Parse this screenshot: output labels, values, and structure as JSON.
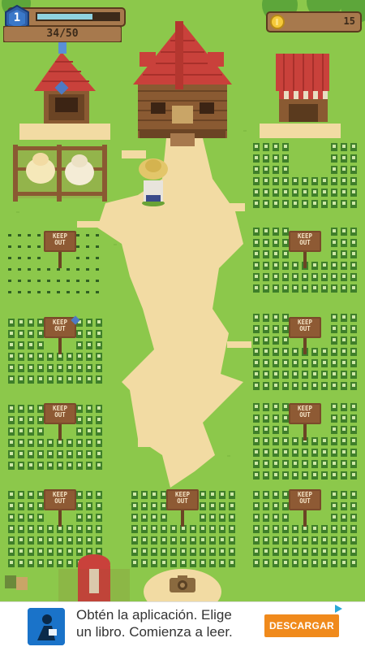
{
  "hud": {
    "level": "1",
    "xp_text": "34/50",
    "xp_progress": 0.68,
    "coins": "15"
  },
  "signs": {
    "keep_out": "KEEP OUT"
  },
  "ad": {
    "line1": "Obtén la aplicación. Elige",
    "line2": "un libro. Comienza a leer.",
    "button": "DESCARGAR"
  },
  "colors": {
    "grass": "#8cc84b",
    "path": "#f2dba3",
    "roof": "#c9413b",
    "wood": "#8a5a32",
    "ad_button": "#f08a1c"
  },
  "icons": [
    "level-shield-icon",
    "coin-icon",
    "camera-icon",
    "ad-choices-icon",
    "reader-app-icon"
  ]
}
